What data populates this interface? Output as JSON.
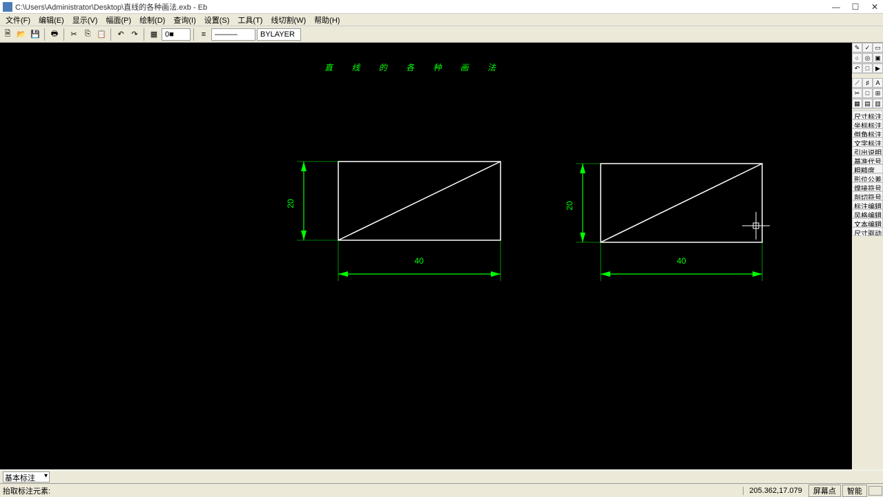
{
  "titlebar": {
    "path": "C:\\Users\\Administrator\\Desktop\\直线的各种画法.exb - Eb"
  },
  "menus": [
    "文件(F)",
    "编辑(E)",
    "显示(V)",
    "幅面(P)",
    "绘制(D)",
    "查询(I)",
    "设置(S)",
    "工具(T)",
    "线切割(W)",
    "帮助(H)"
  ],
  "toolbar": {
    "layer_num": "0■",
    "bylayer": "BYLAYER"
  },
  "canvas": {
    "title_text": "直线的各种画法",
    "dim_v_left": "20",
    "dim_h_left": "40",
    "dim_v_right": "20",
    "dim_h_right": "40"
  },
  "dimlist": [
    "尺寸标注",
    "坐标标注",
    "倒角标注",
    "文字标注",
    "引出说明",
    "基准代号",
    "粗糙度",
    "形位公差",
    "焊接符号",
    "剖切符号",
    "标注编辑",
    "风格编辑",
    "文本编辑",
    "尺寸驱动"
  ],
  "bottom": {
    "style": "基本标注",
    "prompt": "抬取标注元素:",
    "coords": "205.362,17.079",
    "mode1": "屏幕点",
    "mode2": "智能"
  }
}
